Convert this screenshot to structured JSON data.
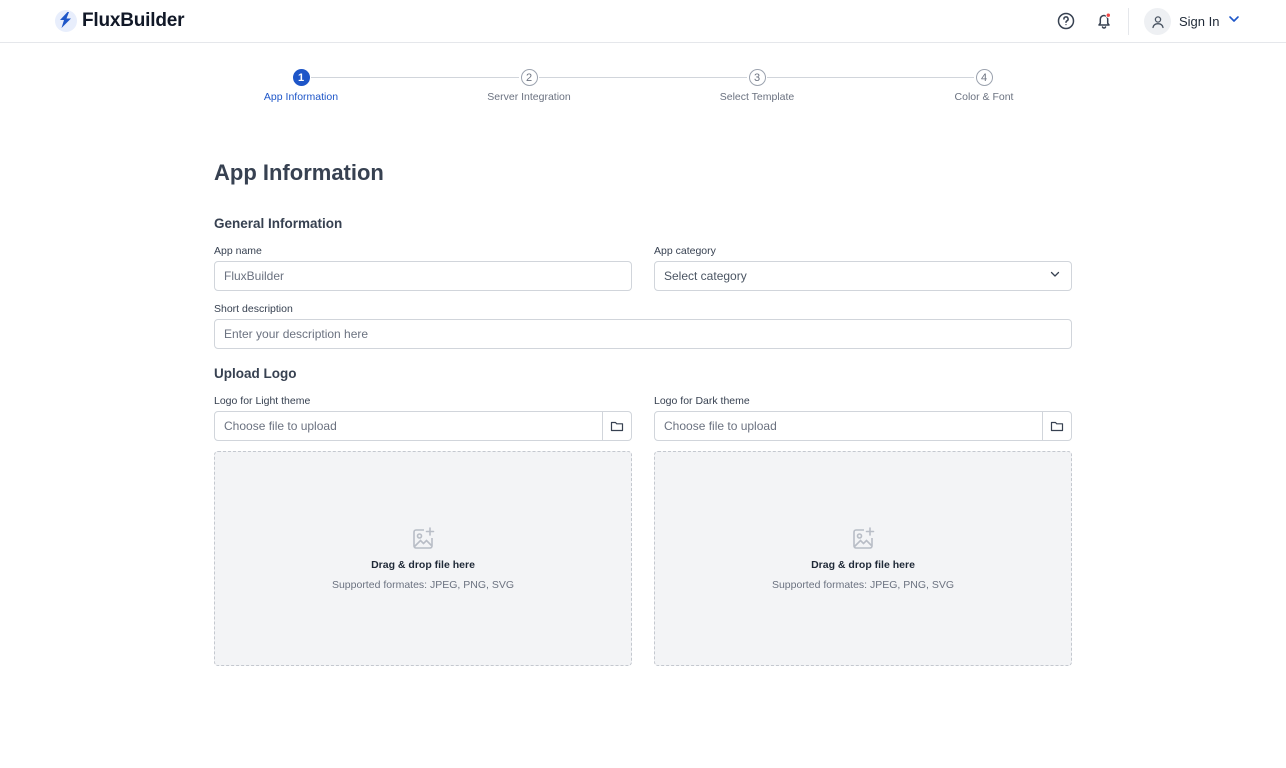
{
  "header": {
    "brand": "FluxBuilder",
    "brand_color": "#1e56c8",
    "help_icon": "help-circle-icon",
    "notification_icon": "bell-icon",
    "notification_dot_color": "#ef4444",
    "user_icon": "user-icon",
    "signin_label": "Sign In"
  },
  "stepper": {
    "active_index": 0,
    "steps": [
      {
        "number": "1",
        "label": "App Information"
      },
      {
        "number": "2",
        "label": "Server Integration"
      },
      {
        "number": "3",
        "label": "Select Template"
      },
      {
        "number": "4",
        "label": "Color & Font"
      }
    ]
  },
  "main": {
    "title": "App Information",
    "general": {
      "heading": "General Information",
      "app_name": {
        "label": "App name",
        "placeholder": "FluxBuilder"
      },
      "app_category": {
        "label": "App category",
        "placeholder": "Select category"
      },
      "short_description": {
        "label": "Short description",
        "placeholder": "Enter your description here"
      }
    },
    "upload": {
      "heading": "Upload Logo",
      "light": {
        "label": "Logo for Light theme",
        "placeholder": "Choose file to upload",
        "drop_title": "Drag & drop file here",
        "drop_sub": "Supported formates: JPEG, PNG, SVG"
      },
      "dark": {
        "label": "Logo for Dark theme",
        "placeholder": "Choose file to upload",
        "drop_title": "Drag & drop file here",
        "drop_sub": "Supported formates: JPEG, PNG, SVG"
      }
    }
  }
}
